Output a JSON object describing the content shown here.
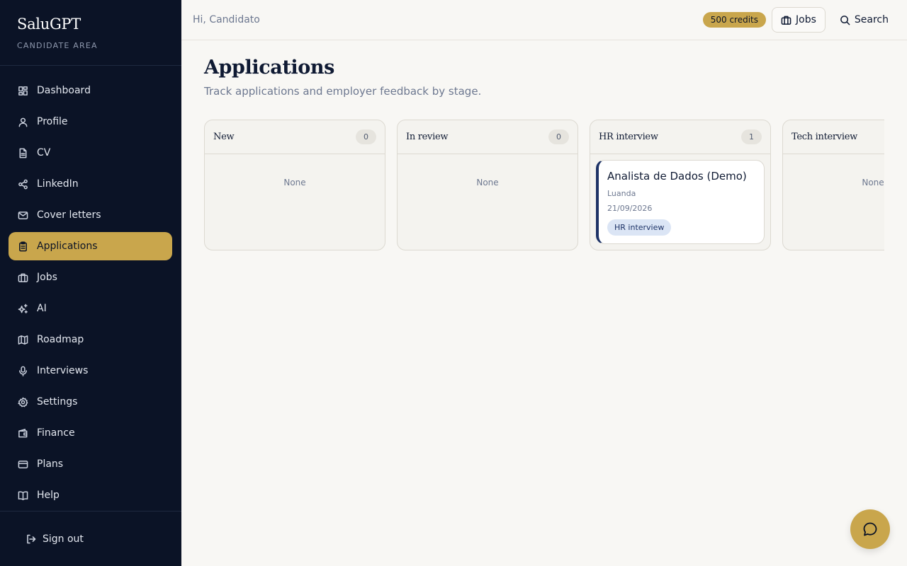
{
  "brand": {
    "name": "SaluGPT",
    "subtitle": "CANDIDATE AREA"
  },
  "sidebar": {
    "items": [
      {
        "label": "Dashboard",
        "icon": "dashboard-icon"
      },
      {
        "label": "Profile",
        "icon": "user-icon"
      },
      {
        "label": "CV",
        "icon": "document-icon"
      },
      {
        "label": "LinkedIn",
        "icon": "share-icon"
      },
      {
        "label": "Cover letters",
        "icon": "mail-icon"
      },
      {
        "label": "Applications",
        "icon": "clipboard-icon",
        "active": true
      },
      {
        "label": "Jobs",
        "icon": "briefcase-icon"
      },
      {
        "label": "AI",
        "icon": "sparkles-icon"
      },
      {
        "label": "Roadmap",
        "icon": "map-icon"
      },
      {
        "label": "Interviews",
        "icon": "microphone-icon"
      },
      {
        "label": "Settings",
        "icon": "gear-icon"
      },
      {
        "label": "Finance",
        "icon": "wallet-icon"
      },
      {
        "label": "Plans",
        "icon": "credit-card-icon"
      },
      {
        "label": "Help",
        "icon": "book-icon"
      }
    ],
    "signout_label": "Sign out"
  },
  "topbar": {
    "greeting": "Hi, Candidato",
    "credits": "500 credits",
    "jobs_label": "Jobs",
    "search_label": "Search"
  },
  "page": {
    "title": "Applications",
    "subtitle": "Track applications and employer feedback by stage."
  },
  "board": {
    "columns": [
      {
        "title": "New",
        "count": "0",
        "empty_text": "None"
      },
      {
        "title": "In review",
        "count": "0",
        "empty_text": "None"
      },
      {
        "title": "HR interview",
        "count": "1",
        "cards": [
          {
            "title": "Analista de Dados (Demo)",
            "location": "Luanda",
            "date": "21/09/2026",
            "badge": "HR interview"
          }
        ]
      },
      {
        "title": "Tech interview",
        "empty_text": "None"
      }
    ]
  },
  "colors": {
    "sidebar_bg": "#0b1326",
    "accent_gold": "#c9a64c",
    "page_bg": "#f8f7f4",
    "card_stripe": "#1d3266"
  },
  "chat_button_icon": "chat-bubble-icon"
}
